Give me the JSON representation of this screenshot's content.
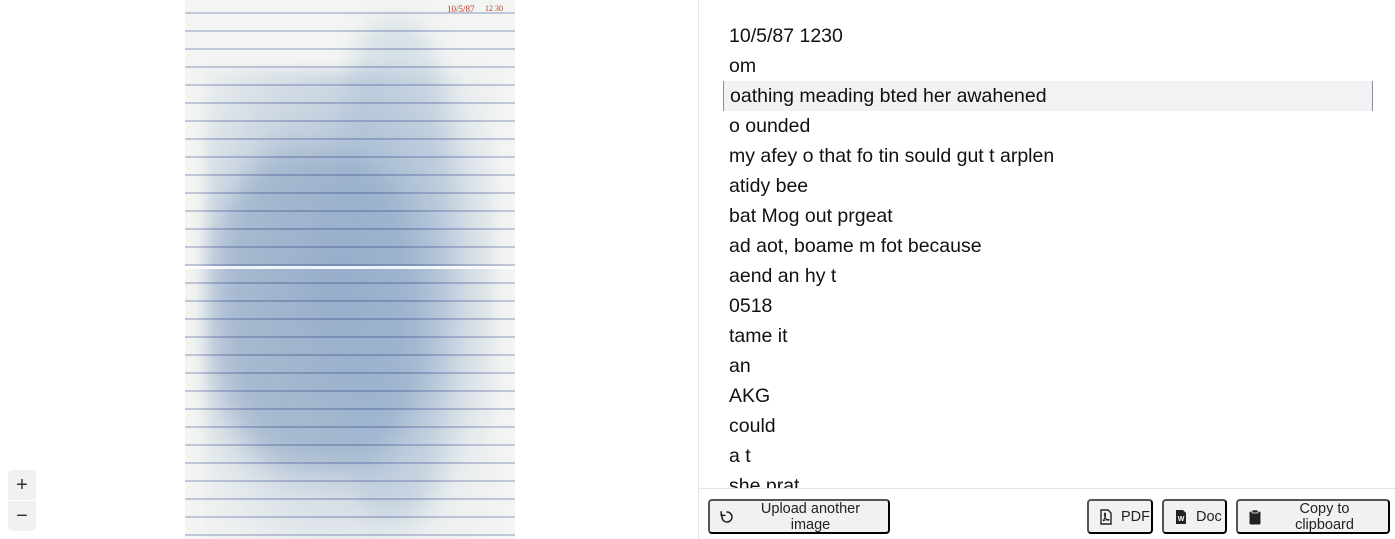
{
  "viewer": {
    "header_marks": [
      "10/5/87",
      "12 30"
    ],
    "zoom_in_label": "+",
    "zoom_out_label": "−"
  },
  "transcript": {
    "lines": [
      "10/5/87 1230",
      "om",
      "oathing meading bted her awahened",
      "o ounded",
      "my afey o that fo tin sould gut t arplen",
      "atidy bee",
      "bat Mog out prgeat",
      "ad aot, boame m fot because",
      "aend an hy t",
      "0518",
      "tame it",
      "an",
      "AKG",
      "could",
      "a t",
      "she prat"
    ],
    "active_index": 2
  },
  "footer": {
    "upload_label": "Upload another image",
    "pdf_label": "PDF",
    "doc_label": "Doc",
    "copy_label": "Copy to clipboard"
  },
  "icons": {
    "upload": "refresh-icon",
    "pdf": "pdf-file-icon",
    "doc": "word-doc-icon",
    "copy": "clipboard-icon"
  }
}
